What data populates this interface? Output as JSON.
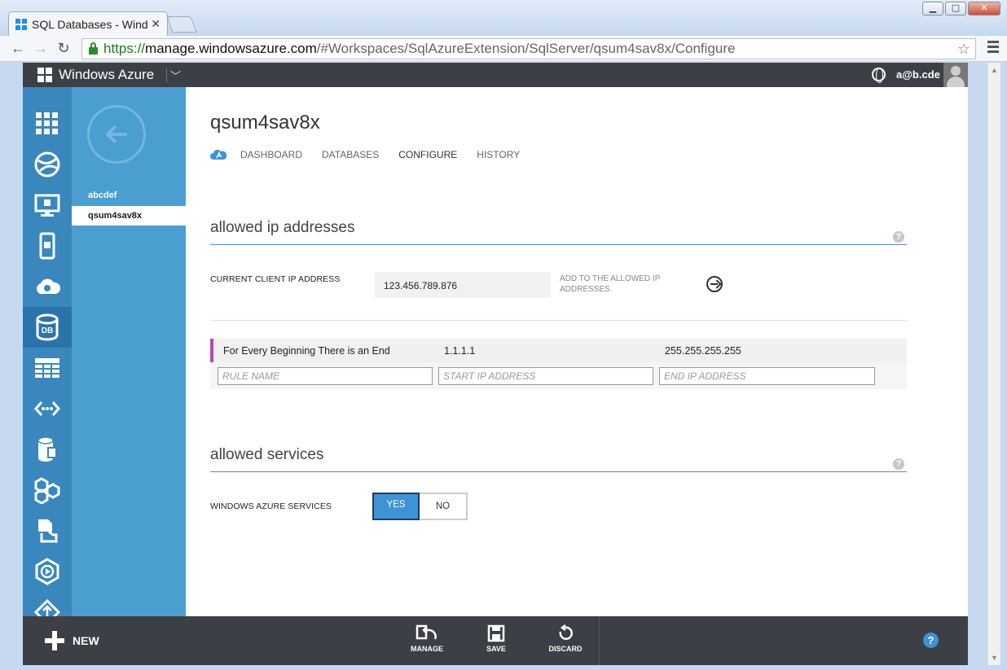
{
  "browser": {
    "tab_title": "SQL Databases - Windows Azure",
    "url_scheme": "https://",
    "url_host": "manage.windowsazure.com",
    "url_path": "/#Workspaces/SqlAzureExtension/SqlServer/qsum4sav8x/Configure"
  },
  "portal": {
    "brand": "Windows Azure",
    "user_email": "a@b.cde"
  },
  "left_nav": {
    "items": [
      {
        "name": "all-items-icon"
      },
      {
        "name": "web-sites-icon"
      },
      {
        "name": "virtual-machines-icon"
      },
      {
        "name": "mobile-services-icon"
      },
      {
        "name": "cloud-services-icon"
      },
      {
        "name": "sql-databases-icon",
        "label": "DB",
        "active": true
      },
      {
        "name": "storage-icon"
      },
      {
        "name": "hdinsight-icon"
      },
      {
        "name": "media-services-icon"
      },
      {
        "name": "service-bus-icon"
      },
      {
        "name": "visual-studio-online-icon"
      },
      {
        "name": "networks-icon"
      },
      {
        "name": "traffic-manager-icon"
      }
    ]
  },
  "subnav": {
    "items": [
      "abcdef",
      "qsum4sav8x"
    ],
    "selected": "qsum4sav8x"
  },
  "page": {
    "title": "qsum4sav8x",
    "tabs": [
      "DASHBOARD",
      "DATABASES",
      "CONFIGURE",
      "HISTORY"
    ],
    "active_tab": "CONFIGURE"
  },
  "allowed_ip": {
    "section_title": "allowed ip addresses",
    "current_ip_label": "CURRENT CLIENT IP ADDRESS",
    "current_ip_value": "123.456.789.876",
    "add_label": "ADD TO THE ALLOWED IP ADDRESSES.",
    "rules": [
      {
        "name": "For Every Beginning There is an End",
        "start_ip": "1.1.1.1",
        "end_ip": "255.255.255.255"
      }
    ],
    "placeholders": {
      "rule_name": "RULE NAME",
      "start_ip": "START IP ADDRESS",
      "end_ip": "END IP ADDRESS"
    }
  },
  "allowed_services": {
    "section_title": "allowed services",
    "label": "WINDOWS AZURE SERVICES",
    "yes": "YES",
    "no": "NO",
    "selected": "YES"
  },
  "commandbar": {
    "new": "NEW",
    "manage": "MANAGE",
    "save": "SAVE",
    "discard": "DISCARD",
    "help": "?"
  },
  "colors": {
    "leftnav": "#3987bd",
    "subnav": "#4a9ed0",
    "accent": "#3e93d5",
    "rule_marker": "#b84aa8",
    "bars": "#3c3f45"
  }
}
